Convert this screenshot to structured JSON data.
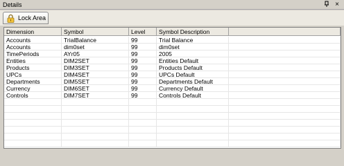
{
  "panel": {
    "title": "Details",
    "pin_glyph": "⌒",
    "close_glyph": "×"
  },
  "toolbar": {
    "lock_label": "Lock Area",
    "lock_icon": "lock-icon"
  },
  "table": {
    "columns": [
      "Dimension",
      "Symbol",
      "Level",
      "Symbol Description"
    ],
    "rows": [
      [
        "Accounts",
        "TrialBalance",
        "99",
        "Trial Balance"
      ],
      [
        "Accounts",
        "dim0set",
        "99",
        "dim0set"
      ],
      [
        "TimePeriods",
        "AYr05",
        "99",
        "2005"
      ],
      [
        "Entities",
        "DIM2SET",
        "99",
        "Entities Default"
      ],
      [
        "Products",
        "DIM3SET",
        "99",
        "Products Default"
      ],
      [
        "UPCs",
        "DIM4SET",
        "99",
        "UPCs Default"
      ],
      [
        "Departments",
        "DIM5SET",
        "99",
        "Departments Default"
      ],
      [
        "Currency",
        "DIM6SET",
        "99",
        "Currency Default"
      ],
      [
        "Controls",
        "DIM7SET",
        "99",
        "Controls Default"
      ],
      [
        "",
        "",
        "",
        ""
      ],
      [
        "",
        "",
        "",
        ""
      ],
      [
        "",
        "",
        "",
        ""
      ],
      [
        "",
        "",
        "",
        ""
      ],
      [
        "",
        "",
        "",
        ""
      ],
      [
        "",
        "",
        "",
        ""
      ],
      [
        "",
        "",
        "",
        ""
      ]
    ]
  }
}
